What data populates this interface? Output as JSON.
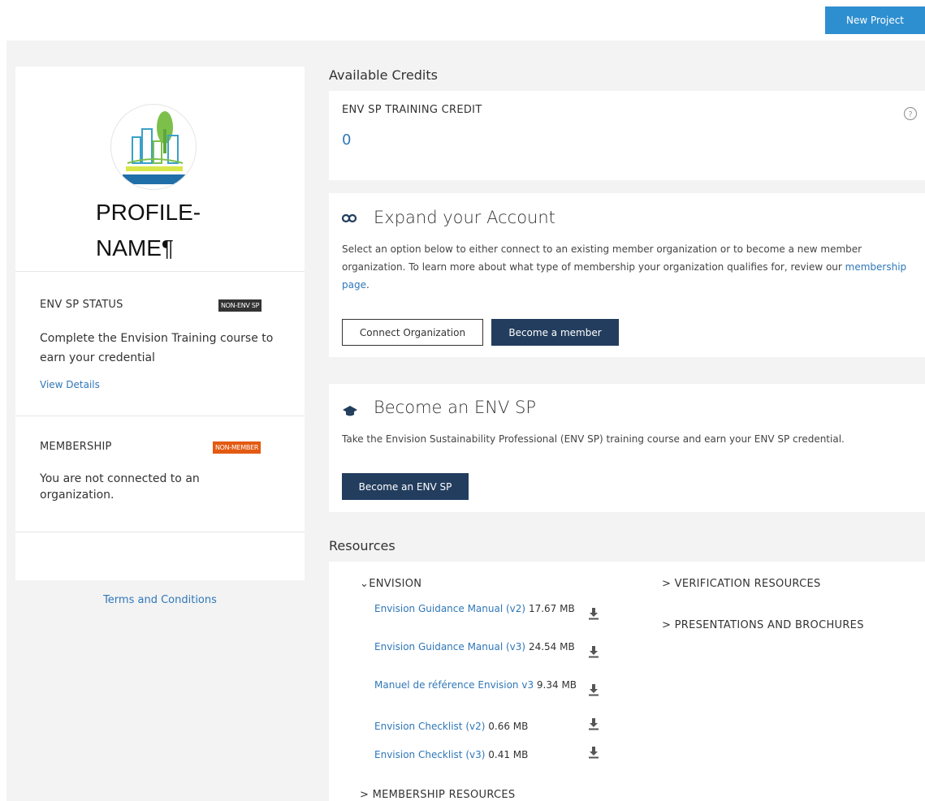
{
  "header": {
    "new_project_label": "New Project"
  },
  "profile": {
    "name": "PROFILE-NAME¶",
    "env_sp": {
      "label": "ENV SP STATUS",
      "badge": "NON-ENV SP",
      "text": "Complete the Envision Training course to earn your credential",
      "link": "View Details"
    },
    "membership": {
      "label": "MEMBERSHIP",
      "badge": "NON-MEMBER",
      "text": "You are not connected to an organization."
    },
    "terms": "Terms and Conditions"
  },
  "credits": {
    "heading": "Available Credits",
    "title": "ENV SP TRAINING CREDIT",
    "value": "0",
    "help_icon": "help-circle-icon"
  },
  "expand": {
    "title": "Expand your Account",
    "text_before": "Select an option below to either connect to an existing member organization or to become a new member organization. To learn more about what type of membership your organization qualifies for, review our ",
    "link": "membership page",
    "text_after": ".",
    "connect_label": "Connect Organization",
    "member_label": "Become a member"
  },
  "envsp": {
    "title": "Become an ENV SP",
    "text": "Take the Envision Sustainability Professional (ENV SP) training course and earn your ENV SP credential.",
    "button_label": "Become an ENV SP"
  },
  "resources": {
    "heading": "Resources",
    "envision": {
      "label": "ENVISION",
      "items": [
        {
          "name": "Envision Guidance Manual (v2)",
          "size": "17.67 MB"
        },
        {
          "name": "Envision Guidance Manual (v3)",
          "size": "24.54 MB"
        },
        {
          "name": "Manuel de référence Envision v3",
          "size": "9.34 MB"
        },
        {
          "name": "Envision Checklist (v2)",
          "size": "0.66 MB"
        },
        {
          "name": "Envision Checklist (v3)",
          "size": "0.41 MB"
        }
      ]
    },
    "verification": "VERIFICATION RESOURCES",
    "presentations": "PRESENTATIONS AND BROCHURES",
    "membership": "MEMBERSHIP RESOURCES"
  },
  "colors": {
    "accent": "#2e8fd0",
    "dark_button": "#233d5e",
    "orange_badge": "#e35a12",
    "link": "#2f77b8"
  }
}
